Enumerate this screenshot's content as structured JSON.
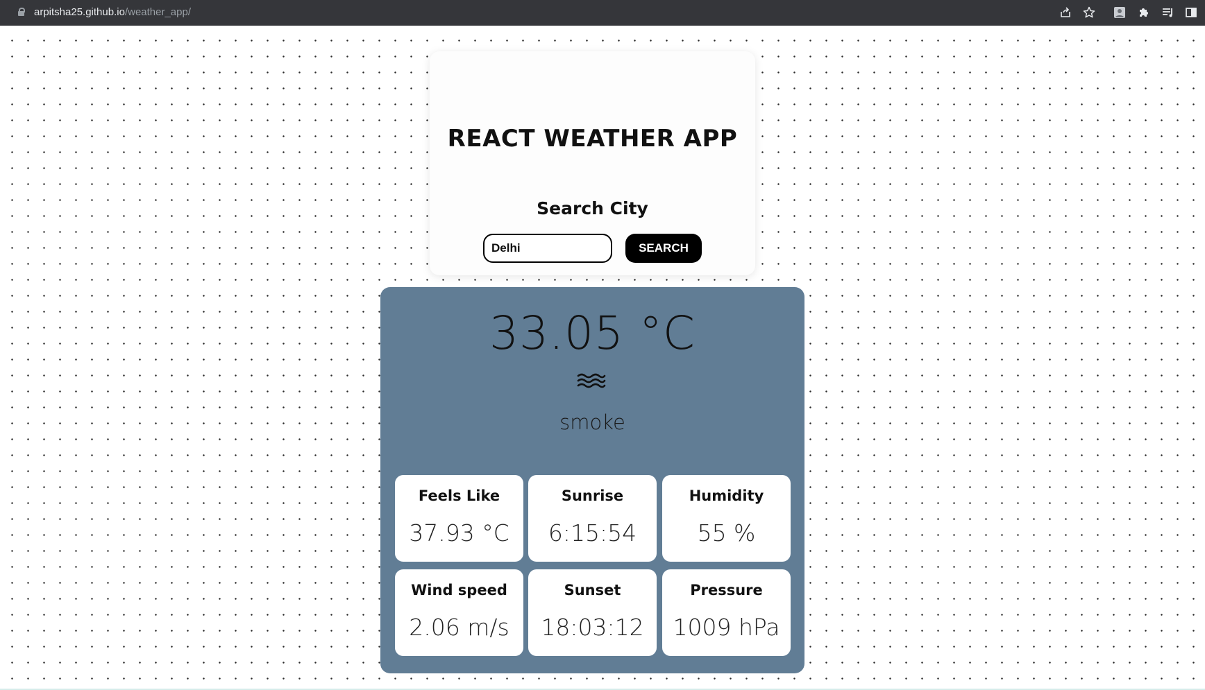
{
  "browser": {
    "url_host": "arpitsha25.github.io",
    "url_path": "/weather_app/"
  },
  "app": {
    "title": "REACT WEATHER APP",
    "search_label": "Search City",
    "search_value": "Delhi",
    "search_button": "SEARCH"
  },
  "weather": {
    "temperature": "33.05 °C",
    "condition_icon": "smoke-icon",
    "condition": "smoke",
    "details": [
      {
        "label": "Feels Like",
        "value": "37.93 °C"
      },
      {
        "label": "Sunrise",
        "value": "6:15:54"
      },
      {
        "label": "Humidity",
        "value": "55 %"
      },
      {
        "label": "Wind speed",
        "value": "2.06 m/s"
      },
      {
        "label": "Sunset",
        "value": "18:03:12"
      },
      {
        "label": "Pressure",
        "value": "1009 hPa"
      }
    ]
  },
  "colors": {
    "weather_card": "#617d95",
    "browser_bar": "#35363a"
  }
}
